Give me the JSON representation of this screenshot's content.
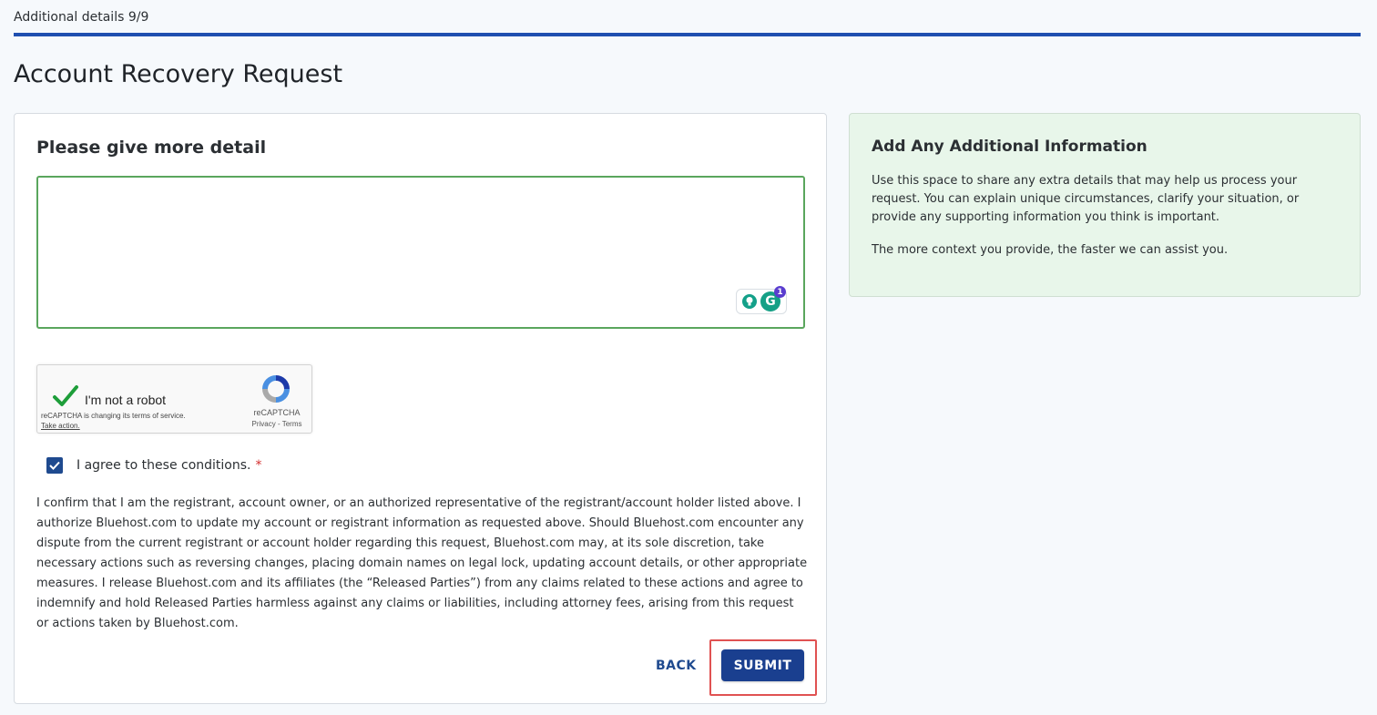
{
  "header": {
    "progress_label": "Additional details 9/9",
    "progress_fraction": 1.0,
    "page_title": "Account Recovery Request"
  },
  "main_card": {
    "heading": "Please give more detail",
    "textarea_value": "",
    "grammarly_badge_count": "1",
    "grammarly_letter": "G",
    "recaptcha": {
      "label": "I'm not a robot",
      "notice": "reCAPTCHA is changing its terms of service.",
      "notice_link": "Take action.",
      "brand": "reCAPTCHA",
      "links": "Privacy - Terms",
      "checked": true
    },
    "agree": {
      "label": "I agree to these conditions.",
      "required_marker": "*",
      "checked": true
    },
    "terms_text": "I confirm that I am the registrant, account owner, or an authorized representative of the registrant/account holder listed above. I authorize Bluehost.com to update my account or registrant information as requested above. Should Bluehost.com encounter any dispute from the current registrant or account holder regarding this request, Bluehost.com may, at its sole discretion, take necessary actions such as reversing changes, placing domain names on legal lock, updating account details, or other appropriate measures. I release Bluehost.com and its affiliates (the “Released Parties”) from any claims related to these actions and agree to indemnify and hold Released Parties harmless against any claims or liabilities, including attorney fees, arising from this request or actions taken by Bluehost.com.",
    "back_label": "BACK",
    "submit_label": "SUBMIT"
  },
  "info_card": {
    "heading": "Add Any Additional Information",
    "paragraph_1": "Use this space to share any extra details that may help us process your request. You can explain unique circumstances, clarify your situation, or provide any supporting information you think is important.",
    "paragraph_2": "The more context you provide, the faster we can assist you."
  },
  "colors": {
    "accent": "#1a3f8f",
    "progress": "#1f4fb0",
    "textarea_border": "#5aa65d",
    "info_bg": "#e8f6ea",
    "required": "#d32f2f",
    "highlight": "#e05252"
  },
  "icons": {
    "recaptcha_check": "checkmark-icon",
    "recaptcha_logo": "recaptcha-logo-icon",
    "agree_checkbox": "checkbox-checked-icon",
    "grammarly_bulb": "lightbulb-icon",
    "grammarly": "grammarly-icon"
  }
}
